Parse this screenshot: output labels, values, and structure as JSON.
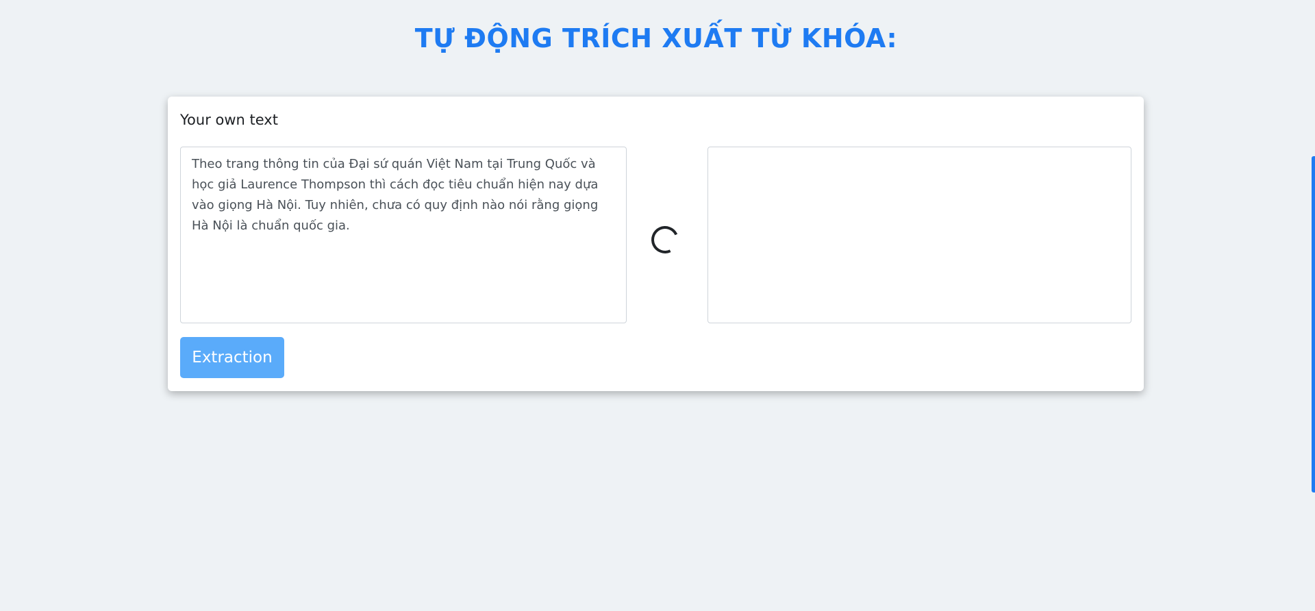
{
  "page": {
    "title": "TỰ ĐỘNG TRÍCH XUẤT TỪ KHÓA:"
  },
  "card": {
    "header": "Your own text",
    "input_text": "Theo trang thông tin của Đại sứ quán Việt Nam tại Trung Quốc và học giả Laurence Thompson thì cách đọc tiêu chuẩn hiện nay dựa vào giọng Hà Nội. Tuy nhiên, chưa có quy định nào nói rằng giọng Hà Nội là chuẩn quốc gia.",
    "output_text": "",
    "button_label": "Extraction",
    "loading": true
  },
  "colors": {
    "accent": "#1e7bf2",
    "button": "#5aabfa",
    "background": "#eef2f5"
  }
}
